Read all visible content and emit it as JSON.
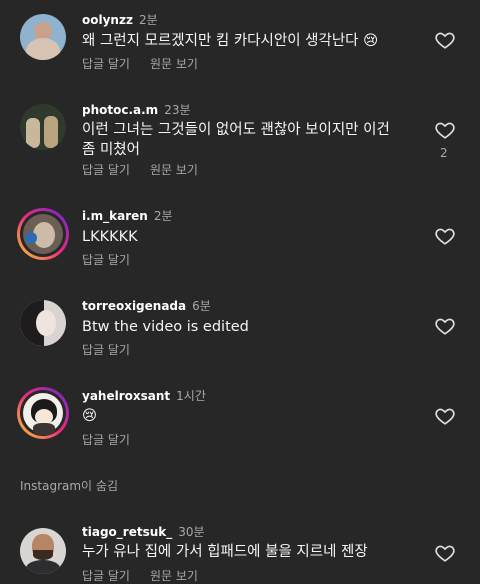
{
  "comments": [
    {
      "username": "oolynzz",
      "time": "2분",
      "text": "왜 그런지 모르겠지만 킴 카다시안이 생각난다 😢",
      "reply": "답글 달기",
      "view_translation": "원문 보기",
      "like_count": ""
    },
    {
      "username": "photoc.a.m",
      "time": "23분",
      "text": "이런 그녀는 그것들이 없어도 괜찮아 보이지만 이건 좀 미쳤어",
      "reply": "답글 달기",
      "view_translation": "원문 보기",
      "like_count": "2"
    },
    {
      "username": "i.m_karen",
      "time": "2분",
      "text": "LKKKKK",
      "reply": "답글 달기",
      "view_translation": "",
      "like_count": ""
    },
    {
      "username": "torreoxigenada",
      "time": "6분",
      "text": "Btw the video is edited",
      "reply": "답글 달기",
      "view_translation": "",
      "like_count": ""
    },
    {
      "username": "yahelroxsant",
      "time": "1시간",
      "text": "😢",
      "reply": "답글 달기",
      "view_translation": "",
      "like_count": ""
    },
    {
      "username": "tiago_retsuk_",
      "time": "30분",
      "text": "누가 유나 집에 가서 힙패드에 불을 지르네 젠장",
      "reply": "답글 달기",
      "view_translation": "원문 보기",
      "like_count": ""
    }
  ],
  "hidden_by_instagram": "Instagram이 숨김",
  "icons": {
    "like": "heart-outline-icon"
  },
  "colors": {
    "background": "#272727",
    "secondary_text": "#a8a8a8",
    "story_ring": "#ee2a7b"
  }
}
